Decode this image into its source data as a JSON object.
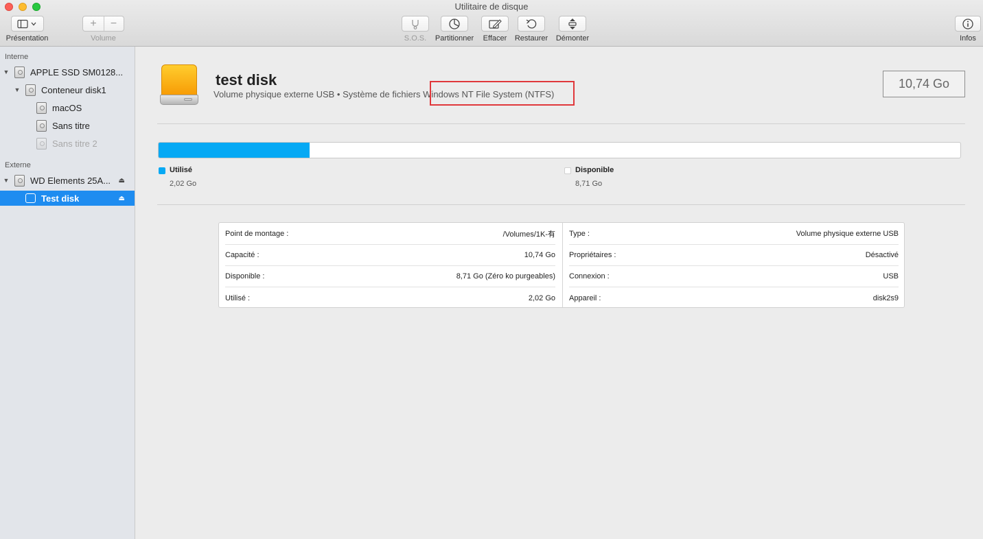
{
  "window": {
    "title": "Utilitaire de disque"
  },
  "toolbar": {
    "presentation_label": "Présentation",
    "volume_label": "Volume",
    "add_symbol": "+",
    "remove_symbol": "−",
    "sos_label": "S.O.S.",
    "partition_label": "Partitionner",
    "erase_label": "Effacer",
    "restore_label": "Restaurer",
    "unmount_label": "Démonter",
    "info_label": "Infos"
  },
  "sidebar": {
    "internal_header": "Interne",
    "external_header": "Externe",
    "items": [
      {
        "label": "APPLE SSD SM0128..."
      },
      {
        "label": "Conteneur disk1"
      },
      {
        "label": "macOS"
      },
      {
        "label": "Sans titre"
      },
      {
        "label": "Sans titre 2"
      },
      {
        "label": "WD Elements 25A..."
      },
      {
        "label": "Test disk"
      }
    ]
  },
  "volume": {
    "name": "test disk",
    "subtitle": "Volume physique externe USB • Système de fichiers ",
    "filesystem": "Windows NT File System (NTFS)",
    "size": "10,74 Go"
  },
  "usage": {
    "used_fraction": 0.188,
    "used_color": "#06a9f4",
    "free_color": "#ffffff",
    "used_label": "Utilisé",
    "used_value": "2,02 Go",
    "free_label": "Disponible",
    "free_value": "8,71 Go"
  },
  "info": {
    "left": [
      {
        "key": "Point de montage :",
        "value": "/Volumes/1K-有"
      },
      {
        "key": "Capacité :",
        "value": "10,74 Go"
      },
      {
        "key": "Disponible :",
        "value": "8,71 Go (Zéro ko purgeables)"
      },
      {
        "key": "Utilisé :",
        "value": "2,02 Go"
      }
    ],
    "right": [
      {
        "key": "Type :",
        "value": "Volume physique externe USB"
      },
      {
        "key": "Propriétaires :",
        "value": "Désactivé"
      },
      {
        "key": "Connexion :",
        "value": "USB"
      },
      {
        "key": "Appareil :",
        "value": "disk2s9"
      }
    ]
  }
}
